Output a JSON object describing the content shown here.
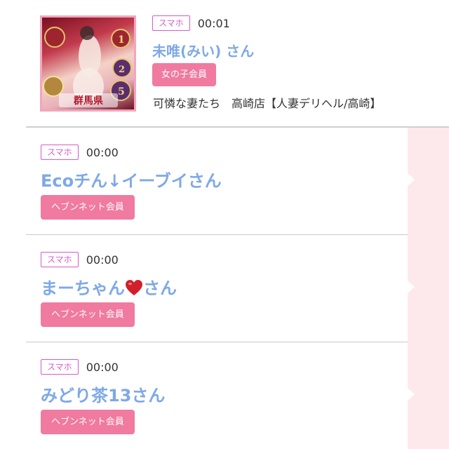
{
  "colors": {
    "name_blue": "#7ea9e6",
    "device_tag_purple": "#d65acb",
    "badge_pink": "#f07aa0",
    "side_strip_pink": "#fde9ec",
    "heart_red": "#d2202a"
  },
  "top_entry": {
    "thumbnail": {
      "icon": "profile-photo",
      "caption": "群馬県",
      "ranking_numbers": [
        "1",
        "2",
        "5"
      ]
    },
    "device": "スマホ",
    "time": "00:01",
    "name": "未唯(みい) さん",
    "badge": "女の子会員",
    "shop": "可憐な妻たち　高崎店【人妻デリヘル/高崎】"
  },
  "entries": [
    {
      "device": "スマホ",
      "time": "00:00",
      "name": "Ecoチん↓イーブイさん",
      "badge": "ヘブンネット会員"
    },
    {
      "device": "スマホ",
      "time": "00:00",
      "name_before_icon": "まーちゃん",
      "name_icon": "heart-icon",
      "name_after_icon": "さん",
      "badge": "ヘブンネット会員"
    },
    {
      "device": "スマホ",
      "time": "00:00",
      "name": "みどり茶13さん",
      "badge": "ヘブンネット会員"
    }
  ]
}
